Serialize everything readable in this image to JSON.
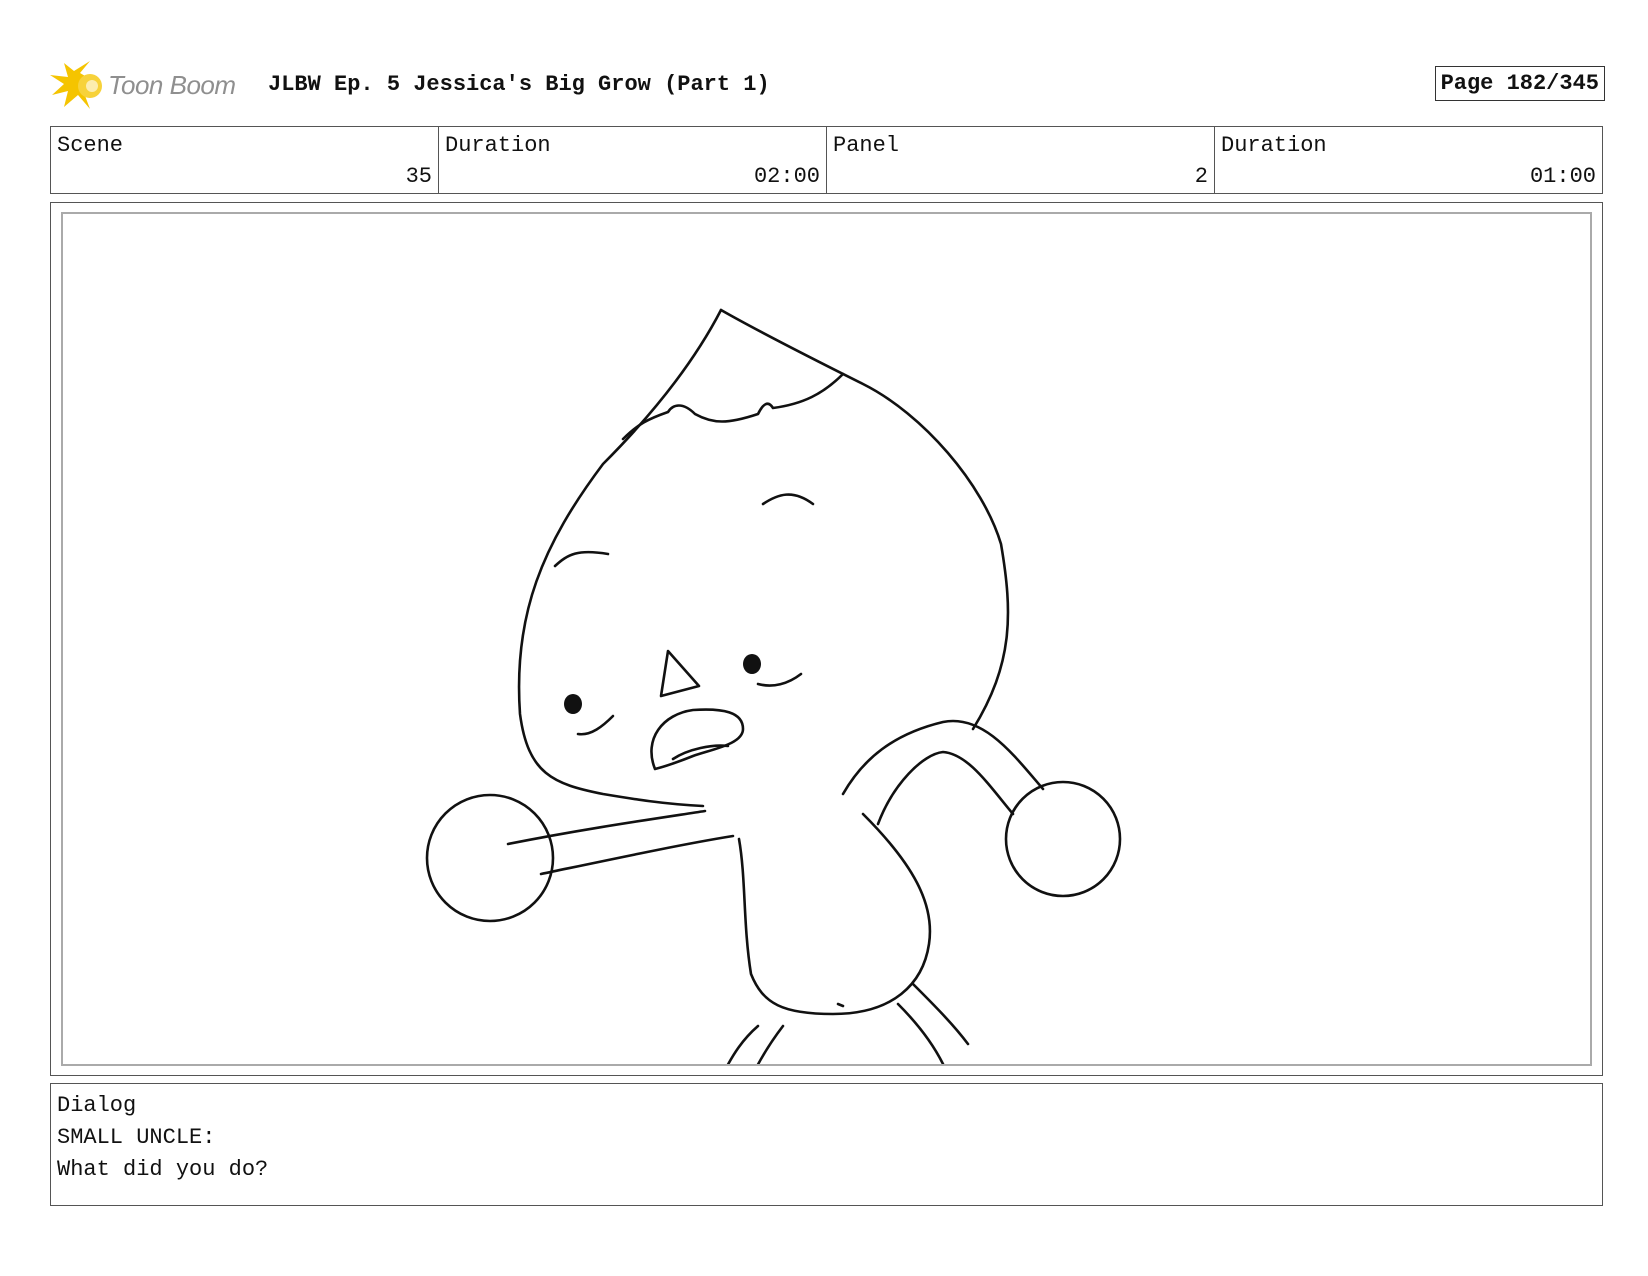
{
  "header": {
    "logo_text": "Toon Boom",
    "title": "JLBW Ep. 5 Jessica's Big Grow (Part 1)",
    "page": "Page 182/345"
  },
  "info": {
    "scene_label": "Scene",
    "scene_value": "35",
    "scene_duration_label": "Duration",
    "scene_duration_value": "02:00",
    "panel_label": "Panel",
    "panel_value": "2",
    "panel_duration_label": "Duration",
    "panel_duration_value": "01:00"
  },
  "dialog": {
    "label": "Dialog",
    "speaker": "SMALL UNCLE:",
    "line": "What did you do?"
  },
  "colors": {
    "logo_accent": "#f5c400",
    "logo_text": "#8f8f8f",
    "border": "#555555",
    "inner_frame": "#aaaaaa"
  },
  "icons": {
    "logo": "toon-boom-starburst-icon"
  }
}
